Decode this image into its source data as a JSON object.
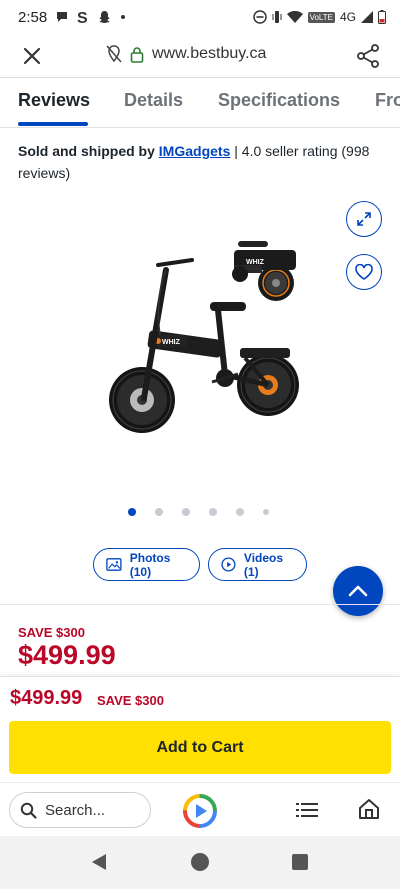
{
  "status_bar": {
    "time": "2:58",
    "network": "4G",
    "volte": "VoLTE"
  },
  "browser": {
    "url": "www.bestbuy.ca",
    "search_placeholder": "Search..."
  },
  "tabs": [
    {
      "label": "Reviews",
      "active": true
    },
    {
      "label": "Details",
      "active": false
    },
    {
      "label": "Specifications",
      "active": false
    },
    {
      "label": "Fro",
      "active": false
    }
  ],
  "seller": {
    "prefix": "Sold and shipped by",
    "name": "IMGadgets",
    "rating_text": "| 4.0 seller rating (998 reviews)"
  },
  "product": {
    "brand_on_image": "WHIZ",
    "image_count": 6,
    "active_image_index": 0
  },
  "media": {
    "photos_label": "Photos (10)",
    "videos_label": "Videos (1)"
  },
  "pricing": {
    "save_label": "SAVE $300",
    "price": "$499.99"
  },
  "sticky_bar": {
    "price": "$499.99",
    "save_label": "SAVE $300",
    "add_to_cart_label": "Add to Cart"
  },
  "colors": {
    "brand_blue": "#0046be",
    "sale_red": "#bb0628",
    "cart_yellow": "#ffe000"
  },
  "icons": [
    "close-icon",
    "no-tracking-icon",
    "lock-icon",
    "share-icon",
    "expand-icon",
    "heart-icon",
    "photo-icon",
    "play-icon",
    "chevron-up-icon",
    "search-icon",
    "google-play-icon",
    "list-icon",
    "home-icon"
  ]
}
